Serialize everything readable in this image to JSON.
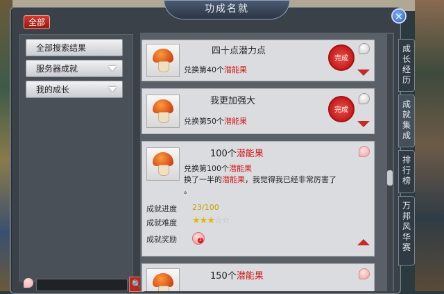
{
  "window": {
    "title": "功成名就",
    "close_label": "×",
    "all_badge": "全部"
  },
  "nav": {
    "items": [
      {
        "label": "全部搜索结果",
        "has_arrow": false
      },
      {
        "label": "服务器成就",
        "has_arrow": true
      },
      {
        "label": "我的成长",
        "has_arrow": true
      }
    ]
  },
  "search": {
    "value": "",
    "button": "🔍"
  },
  "achievements": [
    {
      "title": "四十点潜力点",
      "desc_prefix": "兑换第40个",
      "desc_highlight": "潜能果",
      "completed": true,
      "seal_text": "完成",
      "expanded": false
    },
    {
      "title": "我更加强大",
      "desc_prefix": "兑换第50个",
      "desc_highlight": "潜能果",
      "completed": true,
      "seal_text": "完成",
      "expanded": false
    },
    {
      "title_prefix": "100个",
      "title_highlight": "潜能果",
      "desc_prefix": "兑换第100个",
      "desc_highlight": "潜能果",
      "desc2_prefix": "换了一半的",
      "desc2_highlight": "潜能果",
      "desc2_suffix": "，我觉得我已经非常厉害了",
      "desc3": "。",
      "completed": false,
      "expanded": true,
      "progress_label": "成就进度",
      "progress_value": "23/100",
      "difficulty_label": "成就难度",
      "difficulty_stars": 3,
      "difficulty_max": 5,
      "reward_label": "成就奖励",
      "reward_badge": "2"
    },
    {
      "title_prefix": "150个",
      "title_highlight": "潜能果",
      "completed": false,
      "expanded": false
    }
  ],
  "side_tabs": [
    {
      "label": "成长经历",
      "active": false
    },
    {
      "label": "成就集成",
      "active": true
    },
    {
      "label": "排行榜",
      "active": false
    },
    {
      "label": "万邦风华赛",
      "active": false
    }
  ],
  "colors": {
    "highlight": "#d21818",
    "seal": "#c61d1d",
    "window_bg": "#3a4148"
  }
}
